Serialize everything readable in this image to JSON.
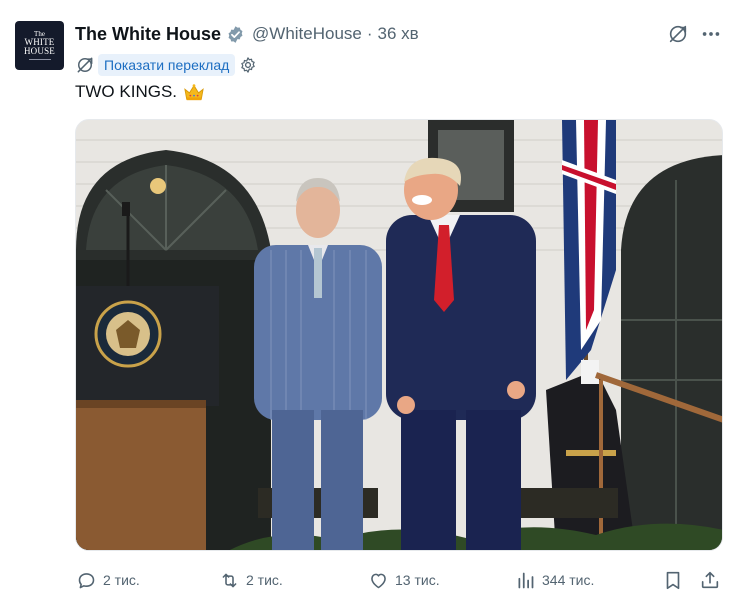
{
  "author": {
    "name": "The White House",
    "handle": "@WhiteHouse",
    "separator": "·",
    "time": "36 хв",
    "avatar_text_top": "The",
    "avatar_text_main_1": "WHITE",
    "avatar_text_main_2": "HOUSE"
  },
  "translate": {
    "label": "Показати переклад"
  },
  "tweet": {
    "text": "TWO KINGS."
  },
  "stats": {
    "replies": "2 тис.",
    "reposts": "2 тис.",
    "likes": "13 тис.",
    "views": "344 тис."
  },
  "icons": {
    "verified": "verified-badge-icon",
    "translate": "translate-icon",
    "more": "more-icon",
    "settings": "gear-icon",
    "crown": "crown-emoji-icon",
    "reply": "reply-icon",
    "repost": "repost-icon",
    "like": "heart-icon",
    "views": "views-icon",
    "bookmark": "bookmark-icon",
    "share": "share-icon"
  },
  "colors": {
    "text": "#0f1419",
    "secondary": "#536471",
    "link": "#1d6ec2",
    "translate_bg": "#e8f1fb",
    "badge": "#829aab"
  }
}
